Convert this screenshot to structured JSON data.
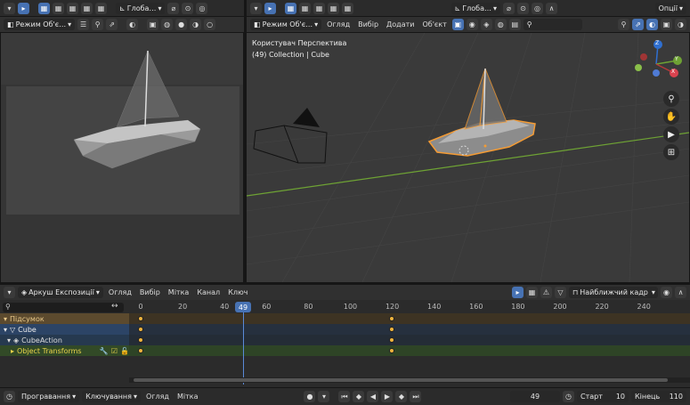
{
  "left_header": {
    "transform": "Глоба…",
    "mode": "Режим Об'є…"
  },
  "right_header": {
    "transform": "Глоба…",
    "options": "Опції",
    "mode": "Режим Об'є…",
    "menus": [
      "Огляд",
      "Вибір",
      "Додати",
      "Об'єкт"
    ]
  },
  "viewport": {
    "overlay_title": "Користувач Перспектива",
    "overlay_sub": "(49) Collection | Cube"
  },
  "gizmo": {
    "z": "Z",
    "y": "Y",
    "x": "X"
  },
  "timeline_header": {
    "editor": "Аркуш Експозиції",
    "menus": [
      "Огляд",
      "Вибір",
      "Мітка",
      "Канал",
      "Ключ"
    ],
    "snap": "Найближчий кадр"
  },
  "timeline": {
    "frames": [
      "0",
      "20",
      "40",
      "49",
      "60",
      "80",
      "100",
      "120",
      "140",
      "160",
      "180",
      "200",
      "220",
      "240"
    ],
    "current": "49",
    "channels": [
      {
        "label": "Підсумок",
        "color": "#5c4a2e"
      },
      {
        "label": "Cube",
        "color": "#2c4466"
      },
      {
        "label": "CubeAction",
        "color": "#26394f"
      },
      {
        "label": "Object Transforms",
        "color": "#324a27"
      }
    ]
  },
  "footer": {
    "menus": [
      "Програвання",
      "Ключування",
      "Огляд",
      "Мітка"
    ],
    "frame": "49",
    "start_label": "Старт",
    "start": "10",
    "end_label": "Кінець",
    "end": "110"
  },
  "colors": {
    "accent": "#4772b3",
    "select": "#f49b34",
    "grid_x": "#b43a3a",
    "grid_y": "#6ea234"
  }
}
